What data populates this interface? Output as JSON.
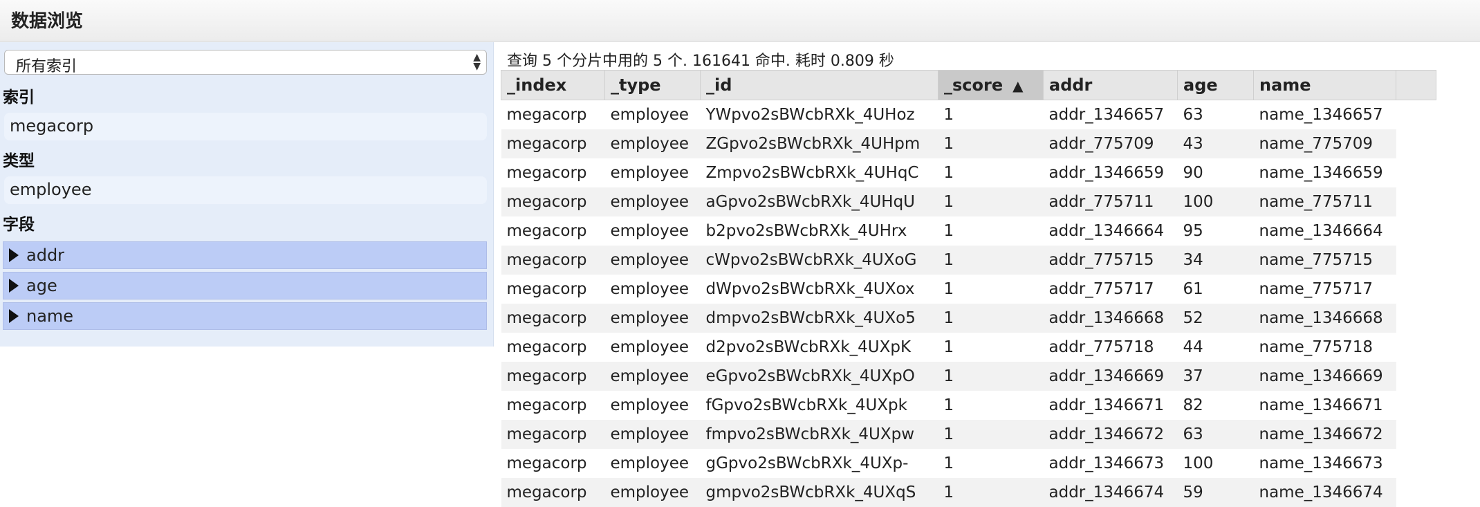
{
  "header": {
    "title": "数据浏览"
  },
  "sidebar": {
    "index_select": "所有索引",
    "index_label": "索引",
    "index_value": "megacorp",
    "type_label": "类型",
    "type_value": "employee",
    "fields_label": "字段",
    "fields": [
      "addr",
      "age",
      "name"
    ]
  },
  "results": {
    "summary": "查询 5 个分片中用的 5 个. 161641 命中. 耗时 0.809 秒",
    "columns": [
      "_index",
      "_type",
      "_id",
      "_score",
      "addr",
      "age",
      "name"
    ],
    "sorted_column": "_score",
    "sort_direction_icon": "▲",
    "rows": [
      [
        "megacorp",
        "employee",
        "YWpvo2sBWcbRXk_4UHoz",
        "1",
        "addr_1346657",
        "63",
        "name_1346657"
      ],
      [
        "megacorp",
        "employee",
        "ZGpvo2sBWcbRXk_4UHpm",
        "1",
        "addr_775709",
        "43",
        "name_775709"
      ],
      [
        "megacorp",
        "employee",
        "Zmpvo2sBWcbRXk_4UHqC",
        "1",
        "addr_1346659",
        "90",
        "name_1346659"
      ],
      [
        "megacorp",
        "employee",
        "aGpvo2sBWcbRXk_4UHqU",
        "1",
        "addr_775711",
        "100",
        "name_775711"
      ],
      [
        "megacorp",
        "employee",
        "b2pvo2sBWcbRXk_4UHrx",
        "1",
        "addr_1346664",
        "95",
        "name_1346664"
      ],
      [
        "megacorp",
        "employee",
        "cWpvo2sBWcbRXk_4UXoG",
        "1",
        "addr_775715",
        "34",
        "name_775715"
      ],
      [
        "megacorp",
        "employee",
        "dWpvo2sBWcbRXk_4UXox",
        "1",
        "addr_775717",
        "61",
        "name_775717"
      ],
      [
        "megacorp",
        "employee",
        "dmpvo2sBWcbRXk_4UXo5",
        "1",
        "addr_1346668",
        "52",
        "name_1346668"
      ],
      [
        "megacorp",
        "employee",
        "d2pvo2sBWcbRXk_4UXpK",
        "1",
        "addr_775718",
        "44",
        "name_775718"
      ],
      [
        "megacorp",
        "employee",
        "eGpvo2sBWcbRXk_4UXpO",
        "1",
        "addr_1346669",
        "37",
        "name_1346669"
      ],
      [
        "megacorp",
        "employee",
        "fGpvo2sBWcbRXk_4UXpk",
        "1",
        "addr_1346671",
        "82",
        "name_1346671"
      ],
      [
        "megacorp",
        "employee",
        "fmpvo2sBWcbRXk_4UXpw",
        "1",
        "addr_1346672",
        "63",
        "name_1346672"
      ],
      [
        "megacorp",
        "employee",
        "gGpvo2sBWcbRXk_4UXp-",
        "1",
        "addr_1346673",
        "100",
        "name_1346673"
      ],
      [
        "megacorp",
        "employee",
        "gmpvo2sBWcbRXk_4UXqS",
        "1",
        "addr_1346674",
        "59",
        "name_1346674"
      ]
    ]
  }
}
